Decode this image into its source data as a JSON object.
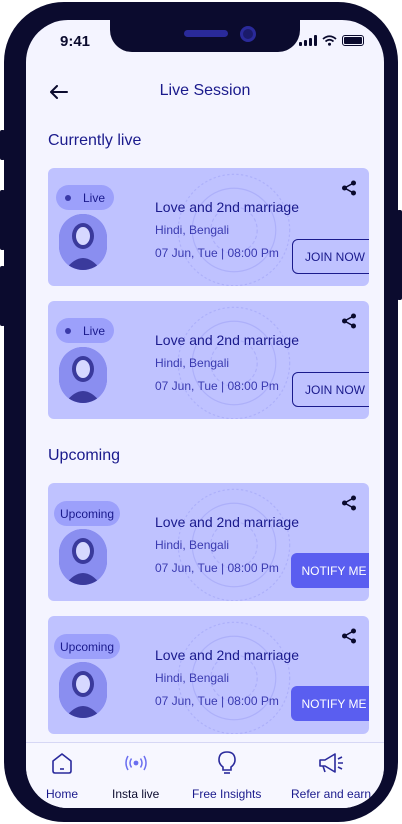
{
  "status_bar": {
    "time": "9:41"
  },
  "header": {
    "title": "Live Session"
  },
  "sections": {
    "live_title": "Currently live",
    "upcoming_title": "Upcoming"
  },
  "live_sessions": [
    {
      "badge": "Live",
      "title": "Love and 2nd marriage",
      "languages": "Hindi, Bengali",
      "datetime": "07 Jun, Tue | 08:00 Pm",
      "action": "JOIN NOW"
    },
    {
      "badge": "Live",
      "title": "Love and 2nd marriage",
      "languages": "Hindi, Bengali",
      "datetime": "07 Jun, Tue | 08:00 Pm",
      "action": "JOIN NOW"
    }
  ],
  "upcoming_sessions": [
    {
      "badge": "Upcoming",
      "title": "Love and 2nd marriage",
      "languages": "Hindi, Bengali",
      "datetime": "07 Jun, Tue | 08:00 Pm",
      "action": "NOTIFY ME"
    },
    {
      "badge": "Upcoming",
      "title": "Love and 2nd marriage",
      "languages": "Hindi, Bengali",
      "datetime": "07 Jun, Tue | 08:00 Pm",
      "action": "NOTIFY ME"
    }
  ],
  "bottom_nav": [
    {
      "label": "Home",
      "icon": "home-icon"
    },
    {
      "label": "Insta live",
      "icon": "broadcast-icon",
      "active": true
    },
    {
      "label": "Free Insights",
      "icon": "lightbulb-icon"
    },
    {
      "label": "Refer and earn",
      "icon": "megaphone-icon"
    }
  ],
  "colors": {
    "accent": "#5a5ef0",
    "card": "#bfc2ff",
    "text": "#1a1a8c"
  }
}
